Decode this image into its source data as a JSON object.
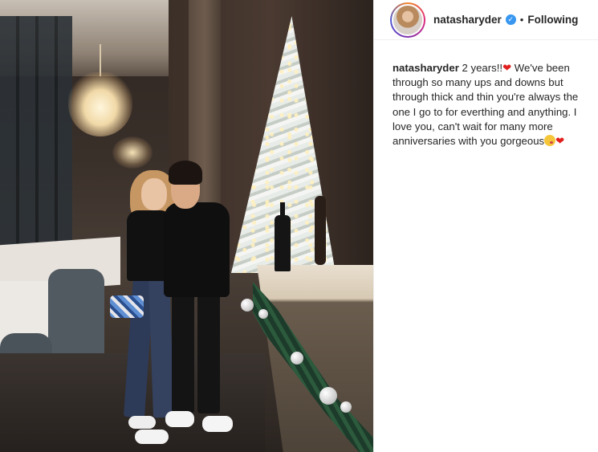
{
  "post": {
    "photo_alt": "",
    "author": {
      "username": "natasharyder",
      "verified_icon": "verified-badge-icon",
      "separator": "•",
      "follow_state": "Following"
    },
    "caption": {
      "username": "natasharyder",
      "text_part1": " 2 years!!",
      "text_part2": " We've been through so many ups and downs but through thick and thin you're always the one I go to for everthing and anything. I love you, can't wait for many more anniversaries with you gorgeous",
      "heart_glyph": "❤",
      "emojis": [
        "red-heart-icon",
        "face-blowing-kiss-icon",
        "red-heart-icon"
      ]
    }
  },
  "colors": {
    "link_blue": "#3897f0",
    "text": "#262626",
    "heart": "#e0201e"
  }
}
